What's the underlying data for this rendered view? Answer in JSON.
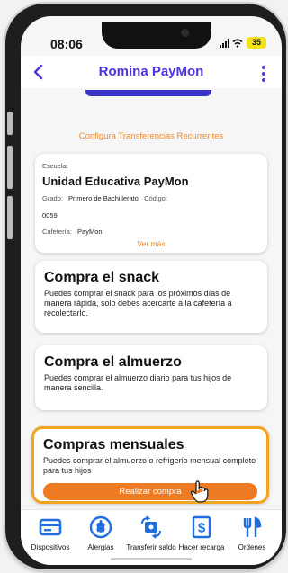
{
  "status_bar": {
    "time": "08:06",
    "battery": "35"
  },
  "header": {
    "title": "Romina PayMon"
  },
  "links": {
    "recurrent_transfers": "Configura Transferencias Recurrentes"
  },
  "school_card": {
    "school_label": "Escuela:",
    "school_name": "Unidad Educativa PayMon",
    "grade_label": "Grado:",
    "grade_value": "Primero de Bachillerato",
    "code_label": "Código:",
    "code_value": "0059",
    "cafeteria_label": "Cafetería:",
    "cafeteria_value": "PayMon",
    "see_more": "Ver más"
  },
  "cards": {
    "snack": {
      "title": "Compra el snack",
      "description": "Puedes comprar el snack para los próximos días de manera rápida, solo debes acercarte a la cafetería a recolectarlo."
    },
    "lunch": {
      "title": "Compra el almuerzo",
      "description": "Puedes comprar el almuerzo diario para tus hijos de manera sencilla."
    },
    "monthly": {
      "title": "Compras mensuales",
      "description": "Puedes comprar el almuerzo o refrigerio mensual completo para tus hijos",
      "button": "Realizar compra"
    }
  },
  "tab_bar": {
    "items": [
      {
        "label": "Dispositivos",
        "icon": "card-icon"
      },
      {
        "label": "Alergias",
        "icon": "wheat-icon"
      },
      {
        "label": "Transferir saldo",
        "icon": "transfer-icon"
      },
      {
        "label": "Hacer recarga",
        "icon": "dollar-receipt-icon"
      },
      {
        "label": "Ordenes",
        "icon": "utensils-icon"
      }
    ]
  },
  "colors": {
    "brand_purple": "#4a35e0",
    "accent_orange": "#ef7a24",
    "highlight_border": "#f2a41f",
    "icon_blue": "#1f6fe0"
  }
}
